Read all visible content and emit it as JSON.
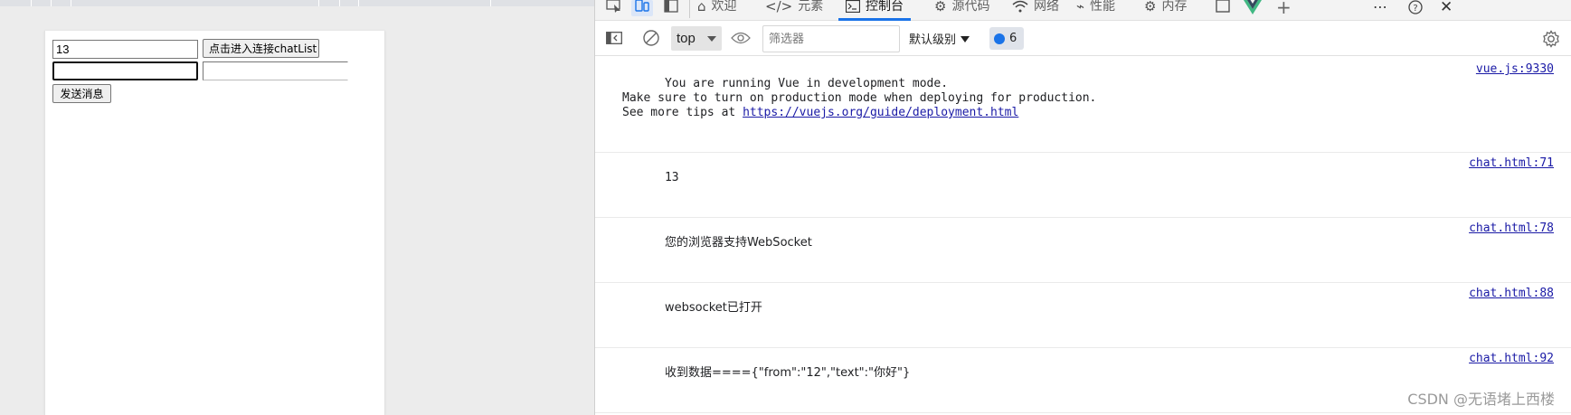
{
  "page": {
    "id_input_value": "13",
    "connect_button_label": "点击进入连接chatList",
    "message_input_value": "",
    "target_input_value": "",
    "send_button_label": "发送消息"
  },
  "devtools": {
    "tabs": [
      {
        "label": "欢迎",
        "icon": "home-icon"
      },
      {
        "label": "元素",
        "icon": "code-icon"
      },
      {
        "label": "控制台",
        "icon": "console-icon",
        "active": true
      },
      {
        "label": "源代码",
        "icon": "bug-icon"
      },
      {
        "label": "网络",
        "icon": "wifi-icon"
      },
      {
        "label": "性能",
        "icon": "performance-icon"
      },
      {
        "label": "内存",
        "icon": "memory-icon"
      }
    ],
    "toolbar": {
      "context": "top",
      "filter_placeholder": "筛选器",
      "level_label": "默认级别",
      "issues_count": "6"
    },
    "console": {
      "messages": [
        {
          "lines": [
            "You are running Vue in development mode.",
            "Make sure to turn on production mode when deploying for production.",
            "See more tips at "
          ],
          "link": "https://vuejs.org/guide/deployment.html",
          "source": "vue.js:9330"
        },
        {
          "text": "13",
          "source": "chat.html:71"
        },
        {
          "text": "您的浏览器支持WebSocket",
          "source": "chat.html:78"
        },
        {
          "text": "websocket已打开",
          "source": "chat.html:88"
        },
        {
          "text": "收到数据===={\"from\":\"12\",\"text\":\"你好\"}",
          "source": "chat.html:92"
        }
      ]
    }
  },
  "watermark": "CSDN @无语堵上西楼",
  "colors": {
    "accent": "#1a73e8",
    "link": "#1a1aa6",
    "vue_green": "#41b883"
  }
}
